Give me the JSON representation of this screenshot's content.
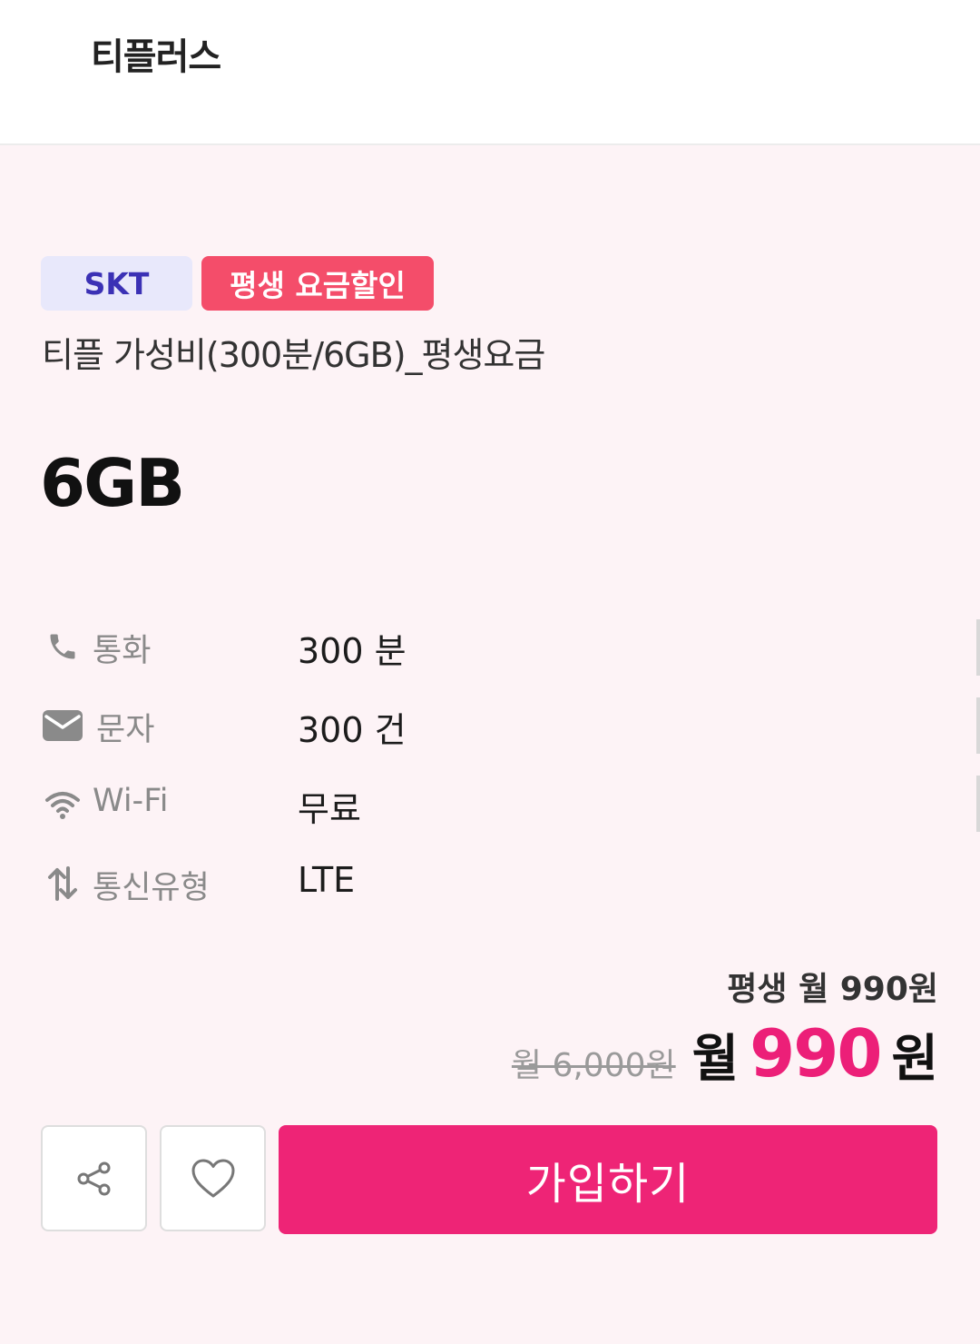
{
  "header": {
    "brand": "티플러스"
  },
  "plan": {
    "carrier_badge": "SKT",
    "promo_badge": "평생 요금할인",
    "name": "티플 가성비(300분/6GB)_평생요금",
    "data": "6GB"
  },
  "specs": [
    {
      "icon": "phone-icon",
      "label": "통화",
      "value": "300 분"
    },
    {
      "icon": "envelope-icon",
      "label": "문자",
      "value": "300 건"
    },
    {
      "icon": "wifi-icon",
      "label": "Wi-Fi",
      "value": "무료"
    },
    {
      "icon": "network-arrows-icon",
      "label": "통신유형",
      "value": "LTE"
    }
  ],
  "price": {
    "lifetime_note": "평생 월 990원",
    "original": "월 6,000원",
    "current_prefix": "월",
    "current_amount": "990",
    "current_suffix": "원"
  },
  "actions": {
    "join_label": "가입하기"
  },
  "colors": {
    "accent": "#ee2476",
    "promo_badge": "#f44d6a",
    "carrier_badge_bg": "#e8e8fb",
    "carrier_badge_text": "#3b31b5",
    "background": "#fdf3f6"
  }
}
